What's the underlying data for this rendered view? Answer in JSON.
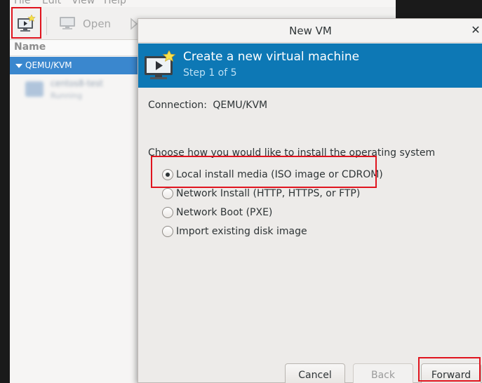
{
  "main_window": {
    "menu": [
      "File",
      "Edit",
      "View",
      "Help"
    ],
    "toolbar": {
      "open_label": "Open"
    },
    "list_header": "Name",
    "connection_row": "QEMU/KVM",
    "vm": {
      "name": "centos8-test",
      "state": "Running"
    }
  },
  "dialog": {
    "title": "New VM",
    "close_glyph": "✕",
    "banner": {
      "title": "Create a new virtual machine",
      "step": "Step 1 of 5"
    },
    "connection_label": "Connection:",
    "connection_value": "QEMU/KVM",
    "install_prompt": "Choose how you would like to install the operating system",
    "options": [
      {
        "label": "Local install media (ISO image or CDROM)",
        "selected": true
      },
      {
        "label": "Network Install (HTTP, HTTPS, or FTP)",
        "selected": false
      },
      {
        "label": "Network Boot (PXE)",
        "selected": false
      },
      {
        "label": "Import existing disk image",
        "selected": false
      }
    ],
    "buttons": {
      "cancel": "Cancel",
      "back": "Back",
      "forward": "Forward"
    }
  },
  "colors": {
    "banner": "#0d78b5",
    "selection": "#3a87ce",
    "highlight": "#e0141e"
  },
  "icons": [
    "new-vm-icon",
    "open-console-icon",
    "run-icon",
    "close-icon",
    "star-icon"
  ]
}
